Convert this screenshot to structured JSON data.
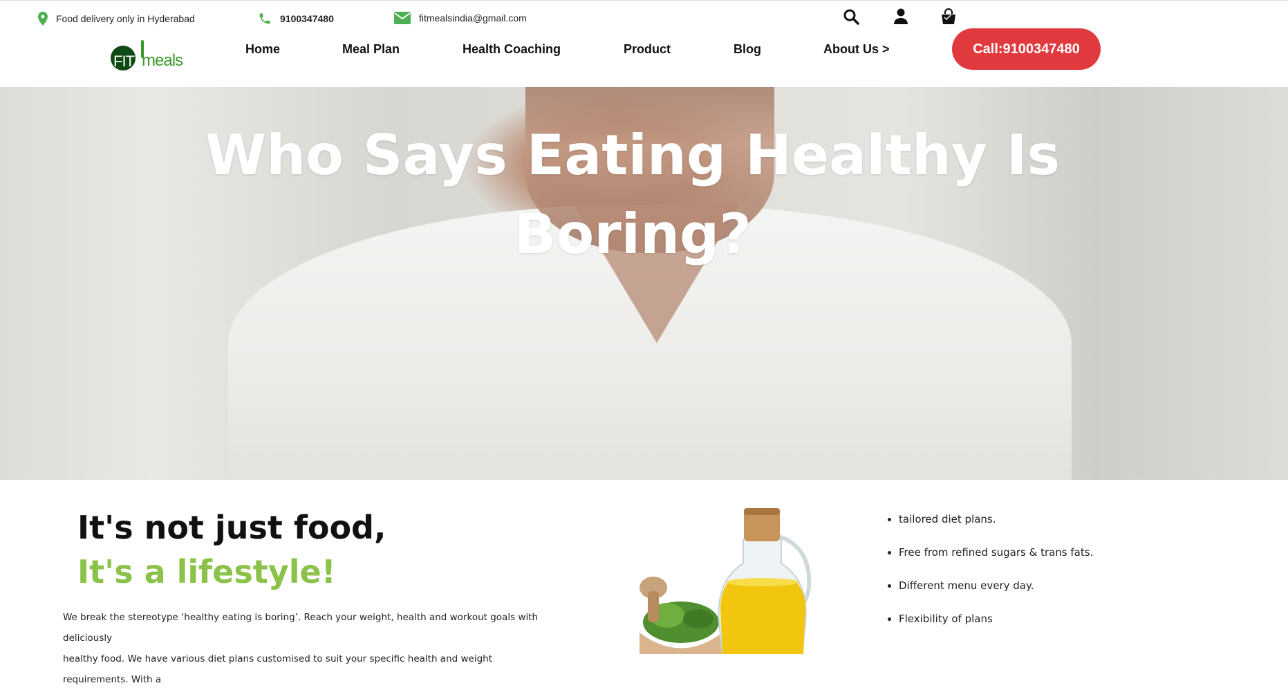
{
  "topbar": {
    "location_text": "Food delivery only in Hyderabad",
    "phone": "9100347480",
    "email": "fitmealsindia@gmail.com"
  },
  "logo": {
    "fit": "FIT",
    "meals": "meals"
  },
  "nav": {
    "items": [
      {
        "label": "Home"
      },
      {
        "label": "Meal Plan"
      },
      {
        "label": "Health Coaching"
      },
      {
        "label": "Product"
      },
      {
        "label": "Blog"
      },
      {
        "label": "About Us >"
      }
    ],
    "call_button": "Call:9100347480"
  },
  "hero": {
    "title_line1": "Who Says Eating Healthy Is",
    "title_line2": "Boring?"
  },
  "intro": {
    "heading_line1": "It's not just food,",
    "heading_line2": "It's a lifestyle!",
    "paragraph_line1": "We break the stereotype ‘healthy eating is boring’. Reach your weight, health and workout goals with deliciously",
    "paragraph_line2": "healthy food. We have various diet plans customised to suit your specific health and weight requirements. With a"
  },
  "features": [
    "tailored diet plans.",
    "Free from refined sugars & trans fats.",
    "Different menu every day.",
    "Flexibility of plans"
  ],
  "colors": {
    "accent_green": "#8bc34a",
    "call_red": "#e0393e",
    "icon_green": "#4caf50"
  }
}
